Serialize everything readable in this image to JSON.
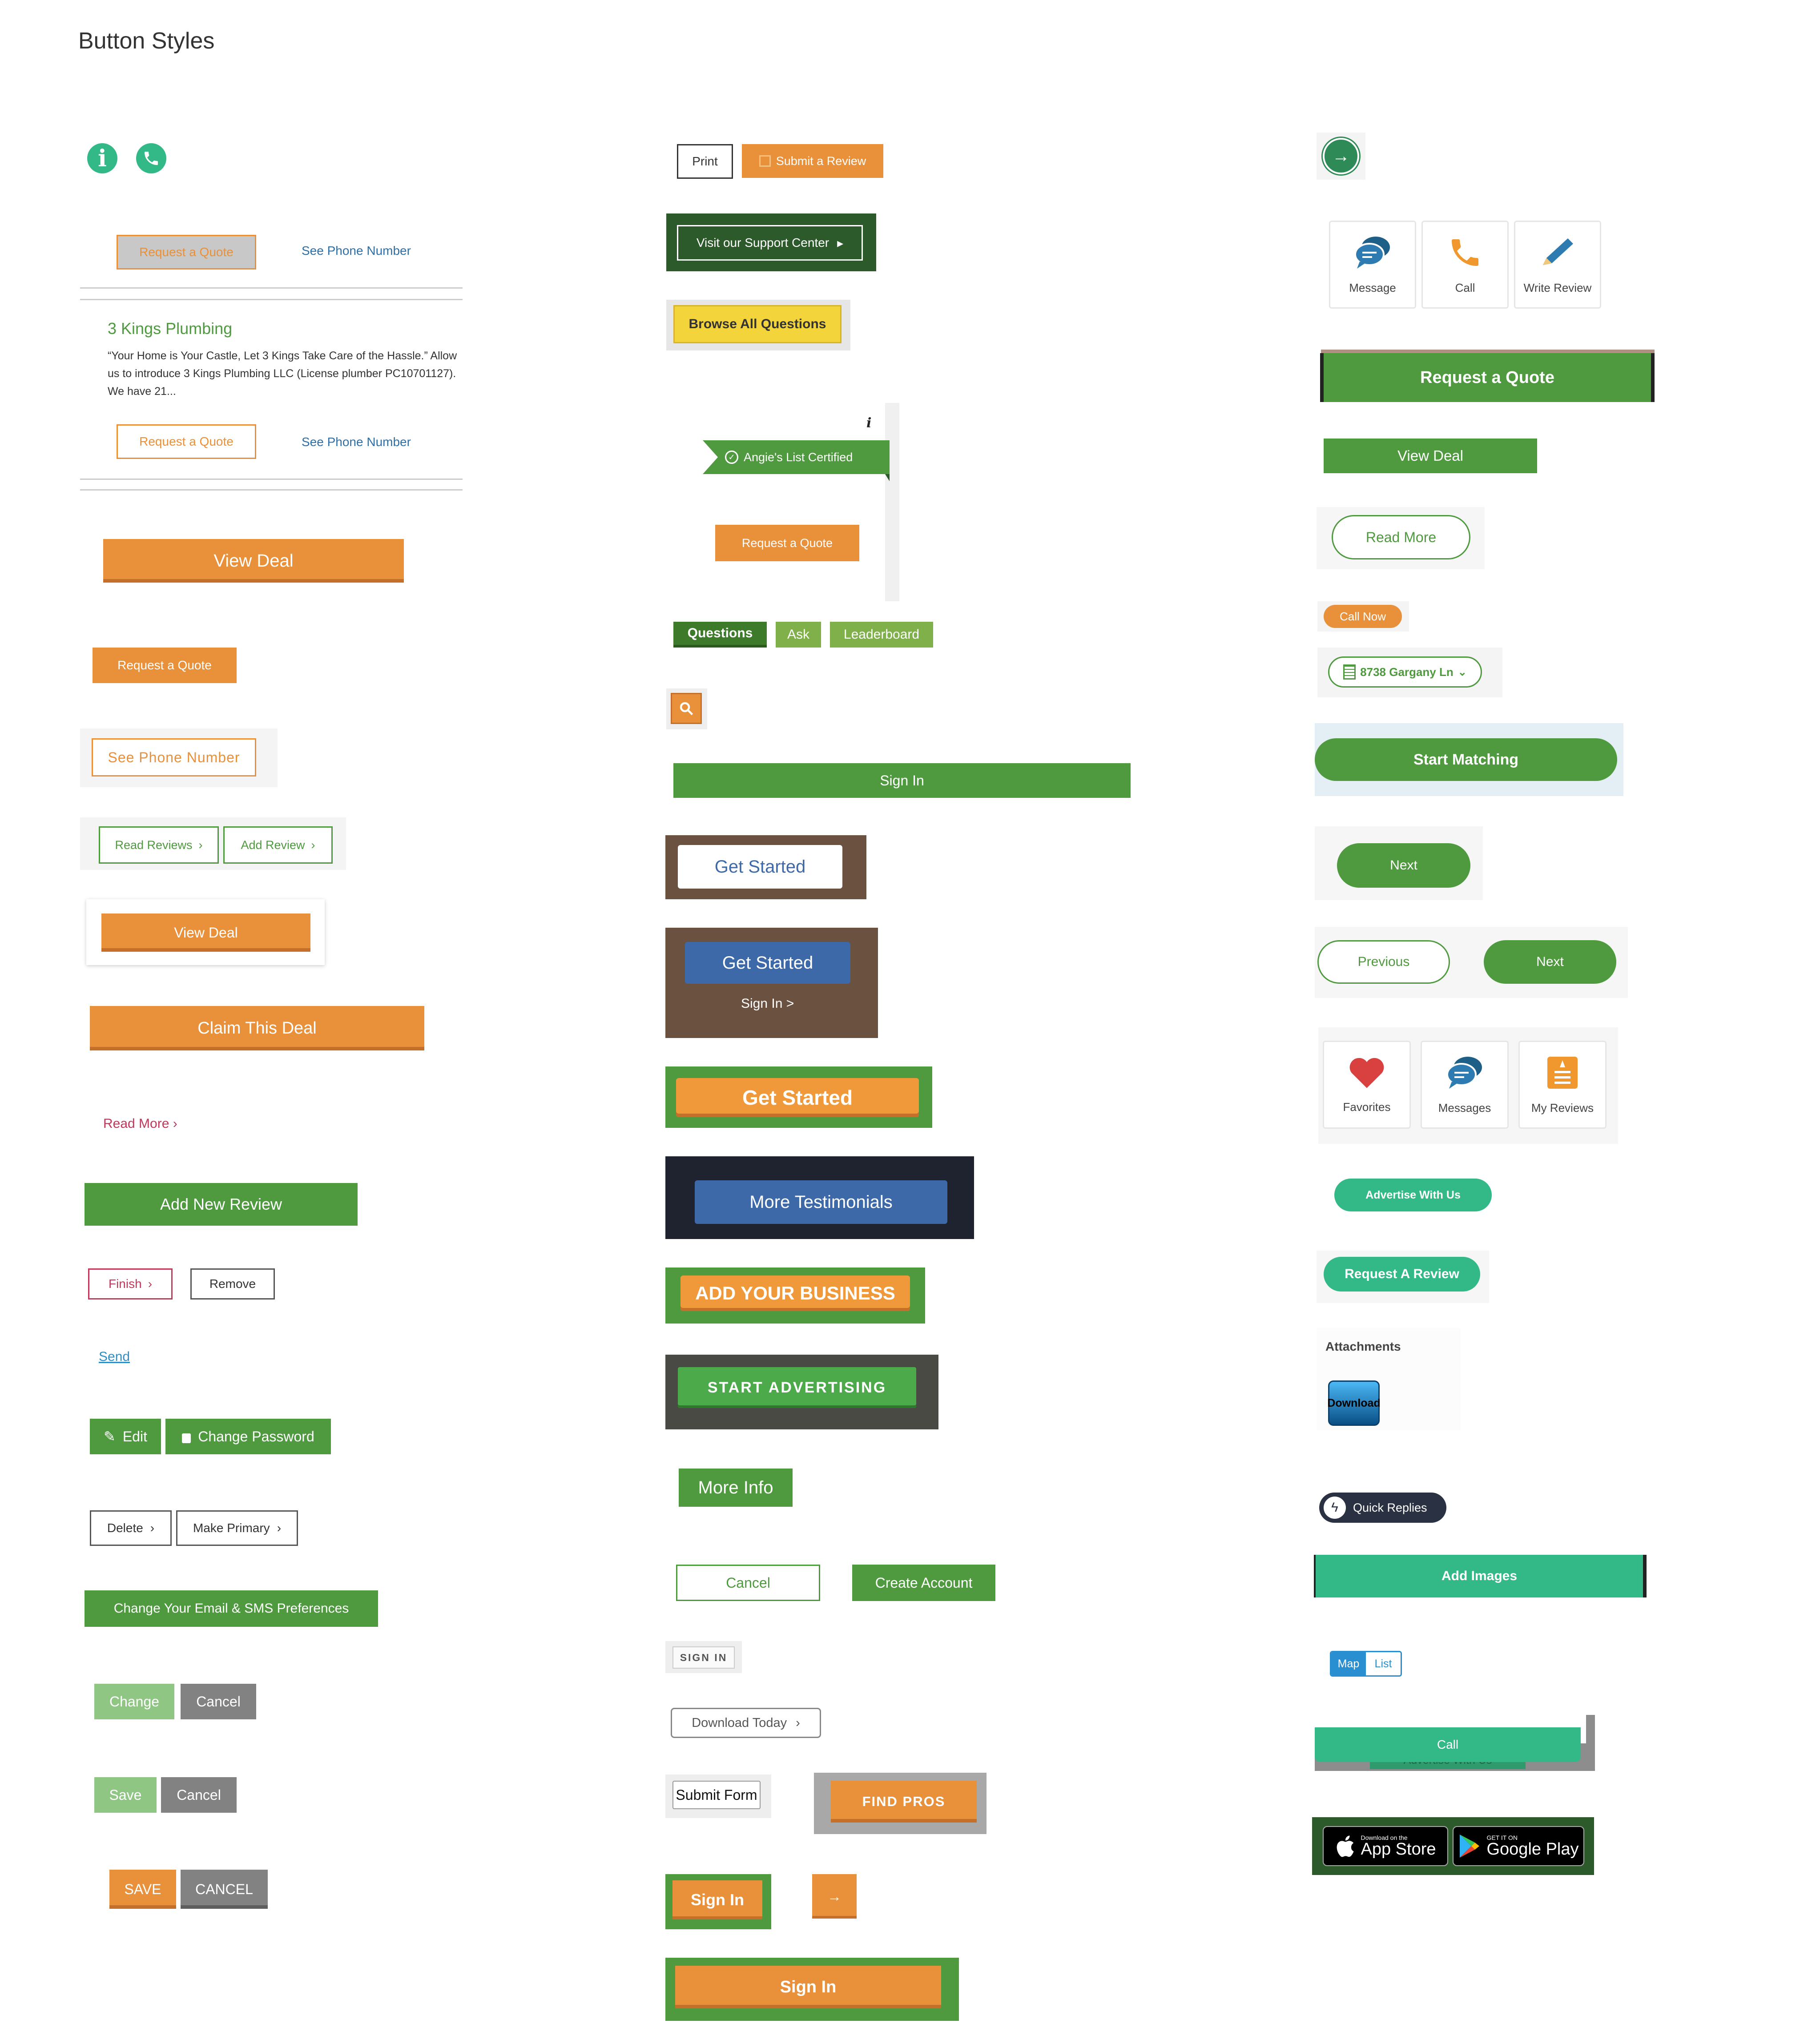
{
  "page_title": "Button Styles",
  "col1": {
    "icons_row": [
      "info-icon",
      "phone-icon"
    ],
    "req_quote_disabled": "Request a Quote",
    "see_phone_1": "See Phone Number",
    "listing": {
      "name": "3 Kings Plumbing",
      "desc": "“Your Home is Your Castle, Let 3 Kings Take Care of the Hassle.” Allow us to introduce 3 Kings Plumbing LLC (License plumber PC10701127). We have 21...",
      "req_quote": "Request a Quote",
      "see_phone": "See Phone Number"
    },
    "view_deal_large": "View Deal",
    "req_quote_solid": "Request a Quote",
    "see_phone_outline": "See Phone Number",
    "read_reviews": "Read Reviews",
    "add_review": "Add Review",
    "view_deal_card": "View Deal",
    "claim_deal": "Claim This Deal",
    "read_more_link": "Read More",
    "add_new_review": "Add New Review",
    "finish": "Finish",
    "remove": "Remove",
    "send": "Send",
    "edit": "Edit",
    "change_password": "Change Password",
    "delete": "Delete",
    "make_primary": "Make Primary",
    "change_email_sms": "Change Your Email & SMS Preferences",
    "change": "Change",
    "cancel_1": "Cancel",
    "save": "Save",
    "cancel_2": "Cancel",
    "save_caps": "SAVE",
    "cancel_caps": "CANCEL"
  },
  "col2": {
    "print": "Print",
    "submit_review": "Submit a Review",
    "support_center": "Visit our Support Center",
    "browse_questions": "Browse All Questions",
    "certified": "Angie's List Certified",
    "info_glyph": "i",
    "req_quote": "Request a Quote",
    "tabs": [
      "Questions",
      "Ask",
      "Leaderboard"
    ],
    "sign_in_bar": "Sign In",
    "get_started_white": "Get Started",
    "get_started_blue": "Get Started",
    "sign_in_link": "Sign In >",
    "get_started_orange": "Get Started",
    "more_testimonials": "More Testimonials",
    "add_business": "ADD YOUR BUSINESS",
    "start_advertising": "START ADVERTISING",
    "more_info": "More Info",
    "cancel": "Cancel",
    "create_account": "Create Account",
    "sign_in_caps": "SIGN IN",
    "download_today": "Download Today",
    "submit_form": "Submit Form",
    "find_pros": "FIND PROS",
    "sign_in_orange": "Sign In",
    "sign_in_wide": "Sign In"
  },
  "col3": {
    "actions": [
      {
        "label": "Message",
        "icon": "message-icon"
      },
      {
        "label": "Call",
        "icon": "phone-icon"
      },
      {
        "label": "Write Review",
        "icon": "pencil-icon"
      }
    ],
    "req_quote_banner": "Request a Quote",
    "view_deal": "View Deal",
    "read_more": "Read More",
    "call_now": "Call Now",
    "address": "8738 Gargany Ln",
    "start_matching": "Start Matching",
    "next_1": "Next",
    "previous": "Previous",
    "next_2": "Next",
    "nav": [
      {
        "label": "Favorites",
        "icon": "heart-icon"
      },
      {
        "label": "Messages",
        "icon": "messages-icon"
      },
      {
        "label": "My Reviews",
        "icon": "reviews-icon"
      }
    ],
    "advertise": "Advertise With Us",
    "req_review": "Request A Review",
    "attachments": "Attachments",
    "download": "Download",
    "quick_replies": "Quick Replies",
    "add_images": "Add Images",
    "map": "Map",
    "list": "List",
    "call": "Call",
    "call_behind": "Advertise With Us",
    "app_store_small": "Download on the",
    "app_store": "App Store",
    "google_small": "GET IT ON",
    "google": "Google Play"
  },
  "colors": {
    "orange": "#e8913a",
    "green": "#4f9a3f",
    "teal": "#33b987",
    "blue": "#3e69a8",
    "dark_green": "#2d5a2a"
  }
}
